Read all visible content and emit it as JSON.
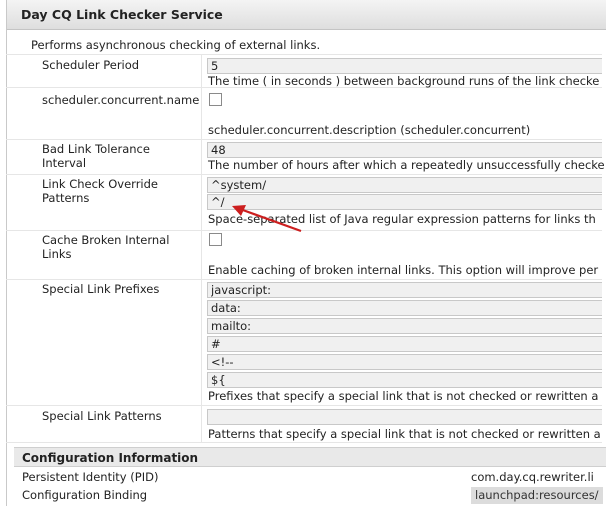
{
  "dialog": {
    "title": "Day CQ Link Checker Service",
    "description": "Performs asynchronous checking of external links."
  },
  "fields": {
    "scheduler_period": {
      "label": "Scheduler Period",
      "value": "5",
      "hint": "The time ( in seconds ) between background runs of the link checke"
    },
    "scheduler_concurrent": {
      "label": "scheduler.concurrent.name",
      "checked": false,
      "hint": "scheduler.concurrent.description (scheduler.concurrent)"
    },
    "bad_link_tolerance": {
      "label": "Bad Link Tolerance Interval",
      "value": "48",
      "hint": "The number of hours after which a repeatedly unsuccessfully checke"
    },
    "override_patterns": {
      "label": "Link Check Override Patterns",
      "values": [
        "^system/",
        "^/"
      ],
      "hint": "Space-separated list of Java regular expression patterns for links th"
    },
    "cache_broken": {
      "label": "Cache Broken Internal Links",
      "checked": false,
      "hint": "Enable caching of broken internal links. This option will improve per"
    },
    "special_prefixes": {
      "label": "Special Link Prefixes",
      "values": [
        "javascript:",
        "data:",
        "mailto:",
        "#",
        "<!--",
        "${"
      ],
      "hint": "Prefixes that specify a special link that is not checked or rewritten a"
    },
    "special_patterns": {
      "label": "Special Link Patterns",
      "value": "",
      "hint": "Patterns that specify a special link that is not checked or rewritten a"
    }
  },
  "config_info": {
    "title": "Configuration Information",
    "pid_label": "Persistent Identity (PID)",
    "pid_value": "com.day.cq.rewriter.li",
    "binding_label": "Configuration Binding",
    "binding_value": "launchpad:resources/"
  },
  "colors": {
    "annotation_arrow": "#cc1f1f"
  }
}
